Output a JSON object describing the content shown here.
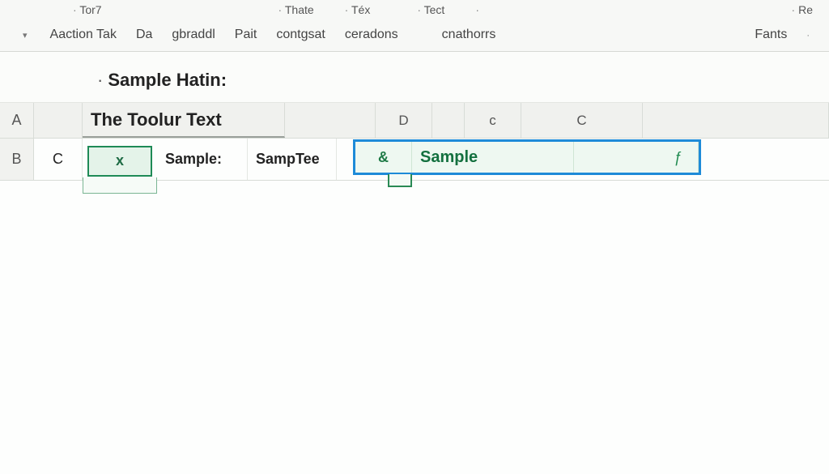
{
  "ribbon": {
    "top": [
      "Tor7",
      "Thate",
      "Téx",
      "Tect",
      "",
      "Re"
    ],
    "tabs": [
      "Aaction Tak",
      "Da",
      "gbraddl",
      "Pait",
      "contgsat",
      "ceradons",
      "cnathorrs",
      "Fants"
    ]
  },
  "subheader": {
    "text": "Sample Hatin:"
  },
  "columns": {
    "a": "A",
    "d": "D",
    "c1": "c",
    "c2": "C"
  },
  "row1": {
    "hdr": "A",
    "title": "The Toolur Text"
  },
  "row2": {
    "hdr": "B",
    "c": "C",
    "x": "x",
    "sample": "Sample:",
    "samptee": "SampTee",
    "amp": "&",
    "sampleSel": "Sample",
    "glyph": "ƒ"
  }
}
